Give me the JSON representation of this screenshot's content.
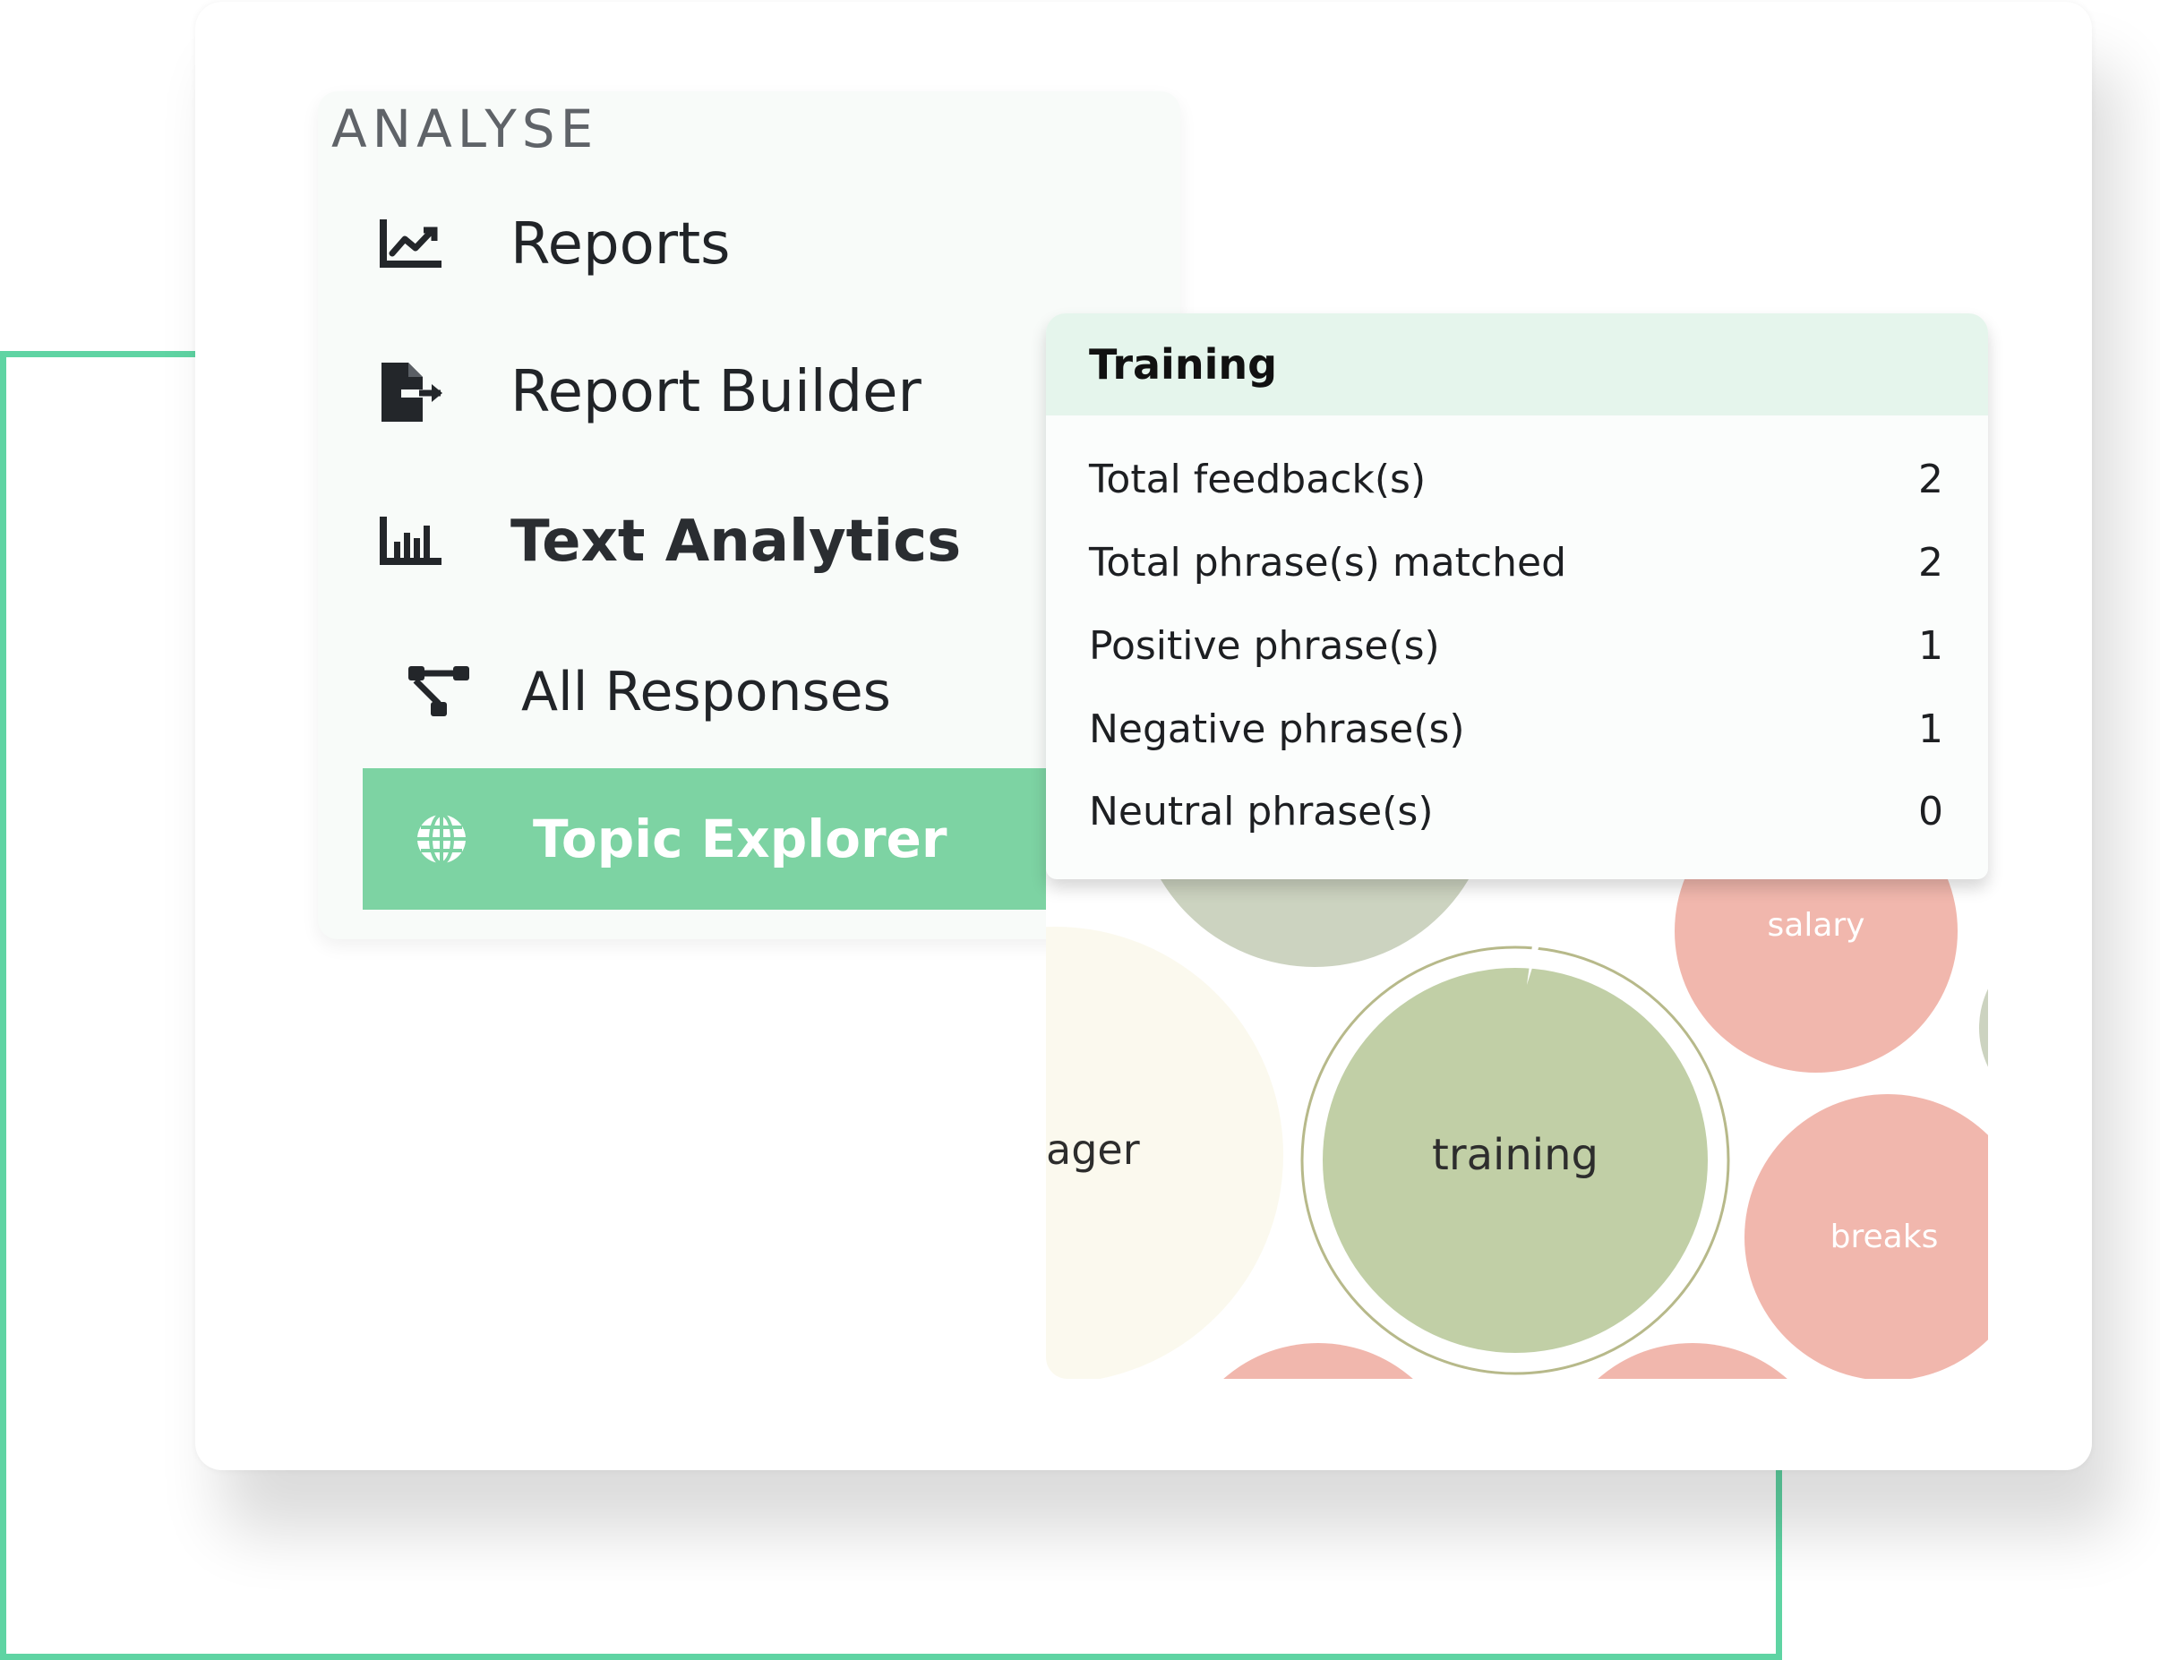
{
  "menu": {
    "section_title": "ANALYSE",
    "items": [
      {
        "label": "Reports",
        "icon": "line-chart-icon"
      },
      {
        "label": "Report Builder",
        "icon": "file-export-icon"
      },
      {
        "label": "Text Analytics",
        "icon": "bar-chart-icon"
      },
      {
        "label": "All Responses",
        "icon": "hierarchy-icon"
      },
      {
        "label": "Topic Explorer",
        "icon": "globe-icon",
        "active": true
      }
    ]
  },
  "popover": {
    "title": "Training",
    "rows": [
      {
        "label": "Total feedback(s)",
        "value": "2"
      },
      {
        "label": "Total phrase(s) matched",
        "value": "2"
      },
      {
        "label": "Positive phrase(s)",
        "value": "1"
      },
      {
        "label": "Negative phrase(s)",
        "value": "1"
      },
      {
        "label": "Neutral phrase(s)",
        "value": "0"
      }
    ]
  },
  "bubbles": {
    "labels": [
      "ager",
      "training",
      "salary",
      "breaks"
    ]
  },
  "colors": {
    "accent": "#7dd3a3",
    "frame_line": "#5fd4a3",
    "header_bg": "#e5f5ec",
    "bubble_positive": "#c1cfa6",
    "bubble_negative": "#f1b7ad",
    "bubble_neutral": "#fbf9ee",
    "bubble_grey": "#ccd3c0"
  }
}
